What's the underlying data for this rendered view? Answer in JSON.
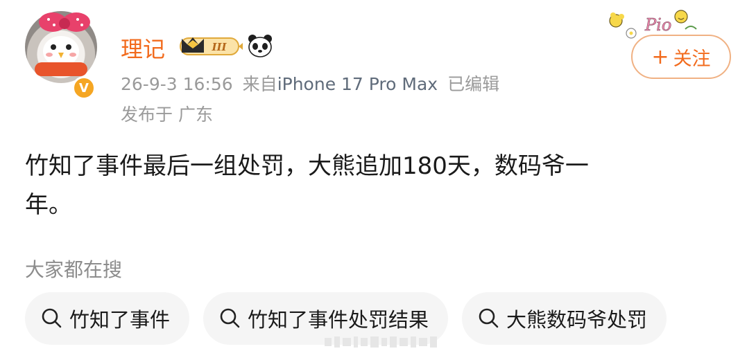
{
  "post": {
    "username": "理记",
    "level_badge": "III",
    "timestamp": "26-9-3 16:56",
    "source_prefix": "来自",
    "device": "iPhone 17 Pro Max",
    "edited": "已编辑",
    "location": "发布于 广东",
    "follow_label": "关注",
    "text_line1": "竹知了事件最后一组处罚，大熊追加180天，数码爷一",
    "text_line2": "年。"
  },
  "search": {
    "title": "大家都在搜",
    "chips": [
      {
        "label": "竹知了事件"
      },
      {
        "label": "竹知了事件处罚结果"
      },
      {
        "label": "大熊数码爷处罚"
      }
    ]
  },
  "colors": {
    "accent": "#f26b1d",
    "meta": "#9a9a9a",
    "chip_bg": "#f5f5f5",
    "verify": "#f5a623"
  },
  "icons": [
    "avatar",
    "verified-badge-icon",
    "crown-level-icon",
    "panda-icon",
    "plus-icon",
    "search-icon",
    "sticker-decoration"
  ]
}
